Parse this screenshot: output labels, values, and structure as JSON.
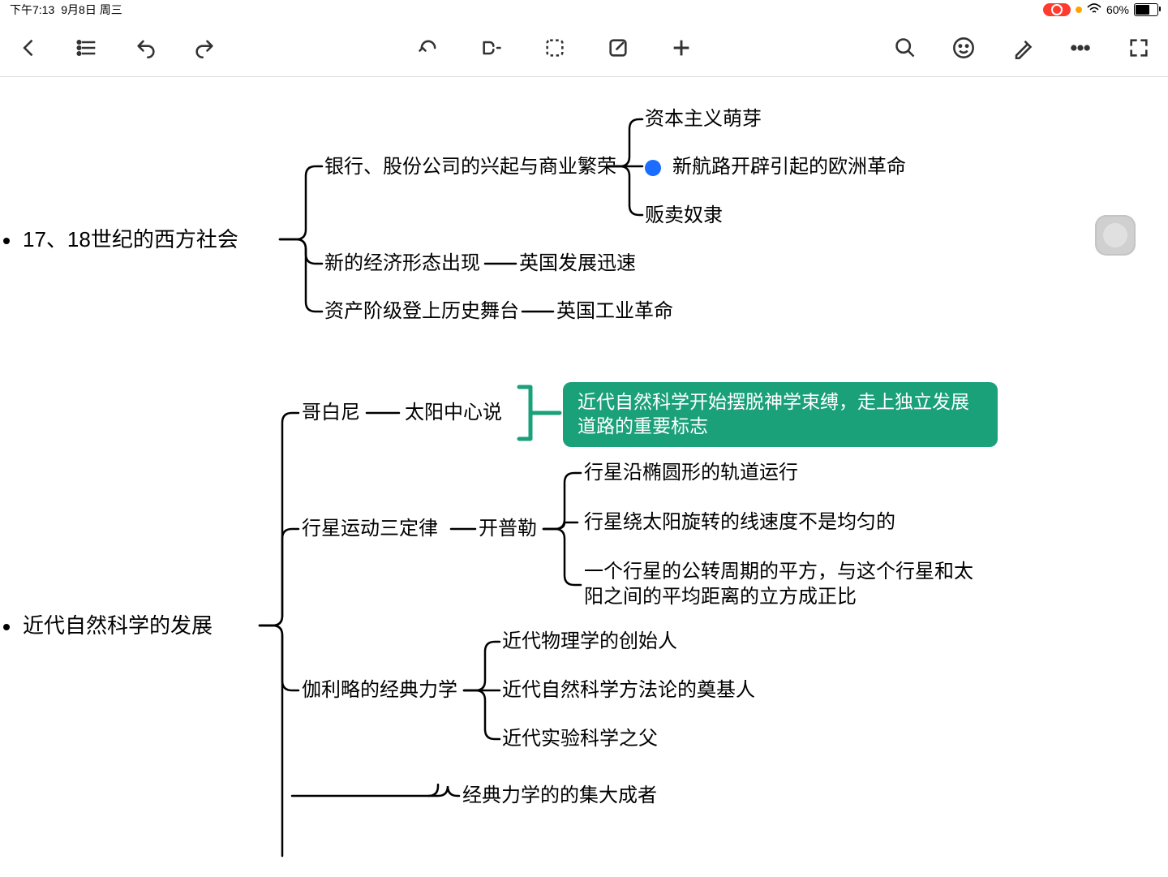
{
  "status": {
    "time": "下午7:13",
    "date": "9月8日 周三",
    "battery": "60%"
  },
  "mindmap": {
    "root1": {
      "label": "17、18世纪的西方社会",
      "children": [
        {
          "label": "银行、股份公司的兴起与商业繁荣",
          "children": [
            {
              "label": "资本主义萌芽"
            },
            {
              "label": "新航路开辟引起的欧洲革命",
              "dot": true
            },
            {
              "label": "贩卖奴隶"
            }
          ]
        },
        {
          "label": "新的经济形态出现",
          "children": [
            {
              "label": "英国发展迅速"
            }
          ]
        },
        {
          "label": "资产阶级登上历史舞台",
          "children": [
            {
              "label": "英国工业革命"
            }
          ]
        }
      ]
    },
    "root2": {
      "label": "近代自然科学的发展",
      "children": [
        {
          "label": "哥白尼",
          "children": [
            {
              "label": "太阳中心说",
              "children": [
                {
                  "label": "近代自然科学开始摆脱神学束缚，走上独立发展道路的重要标志",
                  "green": true
                }
              ]
            }
          ]
        },
        {
          "label": "行星运动三定律",
          "children": [
            {
              "label": "开普勒",
              "children": [
                {
                  "label": "行星沿椭圆形的轨道运行"
                },
                {
                  "label": "行星绕太阳旋转的线速度不是均匀的"
                },
                {
                  "label": "一个行星的公转周期的平方，与这个行星和太阳之间的平均距离的立方成正比"
                }
              ]
            }
          ]
        },
        {
          "label": "伽利略的经典力学",
          "children": [
            {
              "label": "近代物理学的创始人"
            },
            {
              "label": "近代自然科学方法论的奠基人"
            },
            {
              "label": "近代实验科学之父"
            }
          ]
        },
        {
          "label": "经典力学的的集大成者",
          "partial": true
        }
      ]
    }
  }
}
